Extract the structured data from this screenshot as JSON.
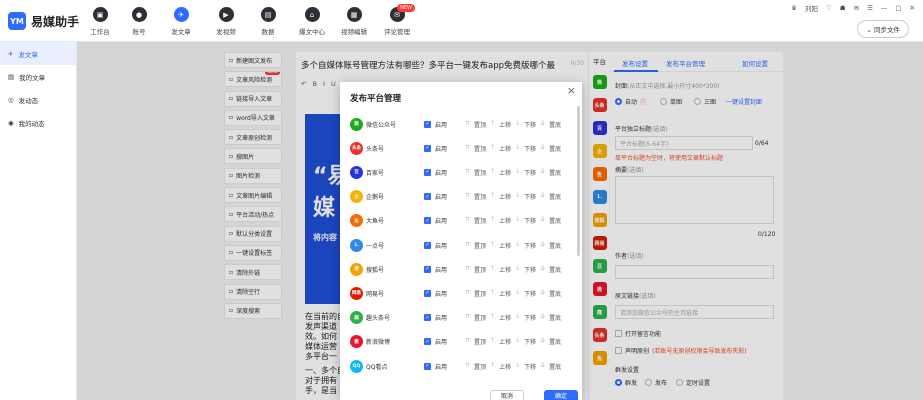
{
  "app": {
    "name": "易媒助手",
    "logo_mark": "YM"
  },
  "topnav": [
    {
      "label": "工作台",
      "icon": "monitor-icon",
      "glyph": "▣"
    },
    {
      "label": "账号",
      "icon": "user-icon",
      "glyph": "●"
    },
    {
      "label": "发文章",
      "icon": "send-icon",
      "glyph": "✈",
      "active": true
    },
    {
      "label": "发视频",
      "icon": "play-icon",
      "glyph": "▶"
    },
    {
      "label": "数据",
      "icon": "data-icon",
      "glyph": "▤"
    },
    {
      "label": "爆文中心",
      "icon": "home-icon",
      "glyph": "⌂"
    },
    {
      "label": "视频编辑",
      "icon": "video-edit-icon",
      "glyph": "▦"
    },
    {
      "label": "评论管理",
      "icon": "comment-icon",
      "glyph": "✉",
      "badge": "NEW"
    }
  ],
  "user": {
    "name": "刘阳",
    "sync_label": "同步文件",
    "window_controls": [
      "—",
      "□",
      "✕"
    ]
  },
  "leftnav": [
    {
      "label": "发文章",
      "active": true
    },
    {
      "label": "我的文章"
    },
    {
      "label": "发动态"
    },
    {
      "label": "我的动态"
    }
  ],
  "tools": [
    {
      "label": "新建图文发布"
    },
    {
      "label": "文章风险检测",
      "badge": "NEW"
    },
    {
      "label": "链接导入文章"
    },
    {
      "label": "word导入文章"
    },
    {
      "label": "文章原创检测"
    },
    {
      "label": "搜图片"
    },
    {
      "label": "图片检测"
    },
    {
      "label": "文章图片编辑"
    },
    {
      "label": "平台活动/热点"
    },
    {
      "label": "默认分类设置"
    },
    {
      "label": "一键设置标签"
    },
    {
      "label": "清除外链"
    },
    {
      "label": "清除空行"
    },
    {
      "label": "深度搜索"
    }
  ],
  "editor": {
    "title": "多个自媒体账号管理方法有哪些？多平台一键发布app免费版哪个最",
    "char_count": "0/30",
    "banner_text": "“易媒",
    "banner_sub": "将内容",
    "body_lines": [
      "在当前的自",
      "发声渠道",
      "效。如何",
      "媒体运营",
      "多平台一",
      "一、多个自",
      "对于拥有",
      "手，是当"
    ]
  },
  "publish_modal": {
    "title": "发布平台管理",
    "enable_label": "启用",
    "ops": [
      "置顶",
      "上移",
      "下移",
      "置底"
    ],
    "ops_glyphs": [
      "⇈",
      "↑",
      "↓",
      "⇊"
    ],
    "platforms": [
      {
        "name": "微信公众号",
        "icon": "wechat-icon",
        "color": "#1aad19",
        "abbr": "微"
      },
      {
        "name": "头条号",
        "icon": "toutiao-icon",
        "color": "#e8322b",
        "abbr": "头条"
      },
      {
        "name": "百家号",
        "icon": "baijiahao-icon",
        "color": "#2932e1",
        "abbr": "百"
      },
      {
        "name": "企鹅号",
        "icon": "penguin-icon",
        "color": "#f5b400",
        "abbr": "企"
      },
      {
        "name": "大鱼号",
        "icon": "dayu-icon",
        "color": "#ff6a00",
        "abbr": "鱼"
      },
      {
        "name": "一点号",
        "icon": "yidian-icon",
        "color": "#2f8ae6",
        "abbr": "1."
      },
      {
        "name": "搜狐号",
        "icon": "sohu-icon",
        "color": "#f5a200",
        "abbr": "搜"
      },
      {
        "name": "网易号",
        "icon": "netease-icon",
        "color": "#d81e06",
        "abbr": "网易"
      },
      {
        "name": "趣头条号",
        "icon": "qutoutiao-icon",
        "color": "#2bb24c",
        "abbr": "趣"
      },
      {
        "name": "新浪微博",
        "icon": "weibo-icon",
        "color": "#e6162d",
        "abbr": "微"
      },
      {
        "name": "QQ看点",
        "icon": "qq-icon",
        "color": "#12b7f5",
        "abbr": "QQ"
      }
    ],
    "cancel_label": "取消",
    "ok_label": "确定"
  },
  "rail": {
    "header": "平台",
    "items": [
      {
        "icon": "wechat-icon",
        "color": "#1aad19",
        "abbr": "微"
      },
      {
        "icon": "toutiao-icon",
        "color": "#e8322b",
        "abbr": "头条"
      },
      {
        "icon": "baijiahao-icon",
        "color": "#2932e1",
        "abbr": "百"
      },
      {
        "icon": "penguin-icon",
        "color": "#f5b400",
        "abbr": "企"
      },
      {
        "icon": "dayu-icon",
        "color": "#ff6a00",
        "abbr": "鱼"
      },
      {
        "icon": "yidian-icon",
        "color": "#2f8ae6",
        "abbr": "1."
      },
      {
        "icon": "sohu-icon",
        "color": "#f5a200",
        "abbr": "搜狐"
      },
      {
        "icon": "netease-icon",
        "color": "#d81e06",
        "abbr": "网易"
      },
      {
        "icon": "douban-icon",
        "color": "#2bb24c",
        "abbr": "豆"
      },
      {
        "icon": "weibo-icon",
        "color": "#e6162d",
        "abbr": "微"
      },
      {
        "icon": "qutoutiao-icon",
        "color": "#2bb24c",
        "abbr": "趣"
      },
      {
        "icon": "toutiao2-icon",
        "color": "#e8322b",
        "abbr": "头条"
      },
      {
        "icon": "tuniu-icon",
        "color": "#f5a200",
        "abbr": "兔"
      }
    ]
  },
  "settings": {
    "tab_publish": "发布设置",
    "tab_platform": "发布平台管理",
    "help_link": "如何设置",
    "cover_label": "封面",
    "cover_hint": "(从正文中选择,最小尺寸400*300)",
    "cover_options": [
      "自动",
      "单图",
      "三图"
    ],
    "one_click_cover": "一键设置封面",
    "title_label": "平台独立标题",
    "title_hint": "(选填)",
    "title_placeholder": "平台标题(5-64字)",
    "title_count": "0/64",
    "title_warn": "单平台标题为空时，将使用文章默认标题",
    "summary_label": "摘要",
    "summary_hint": "(选填)",
    "summary_count": "0/120",
    "author_label": "作者",
    "author_hint": "(选填)",
    "link_label": "原文链接",
    "link_hint": "(选填)",
    "link_placeholder": "请添加微信公众号的主页链接",
    "open_comment": "打开留言功能",
    "original_label": "声明原创",
    "original_note": "(若账号无原创权限会导致发布失败)",
    "send_label": "群发设置",
    "send_options": [
      "群发",
      "发布",
      "定时设置"
    ]
  }
}
